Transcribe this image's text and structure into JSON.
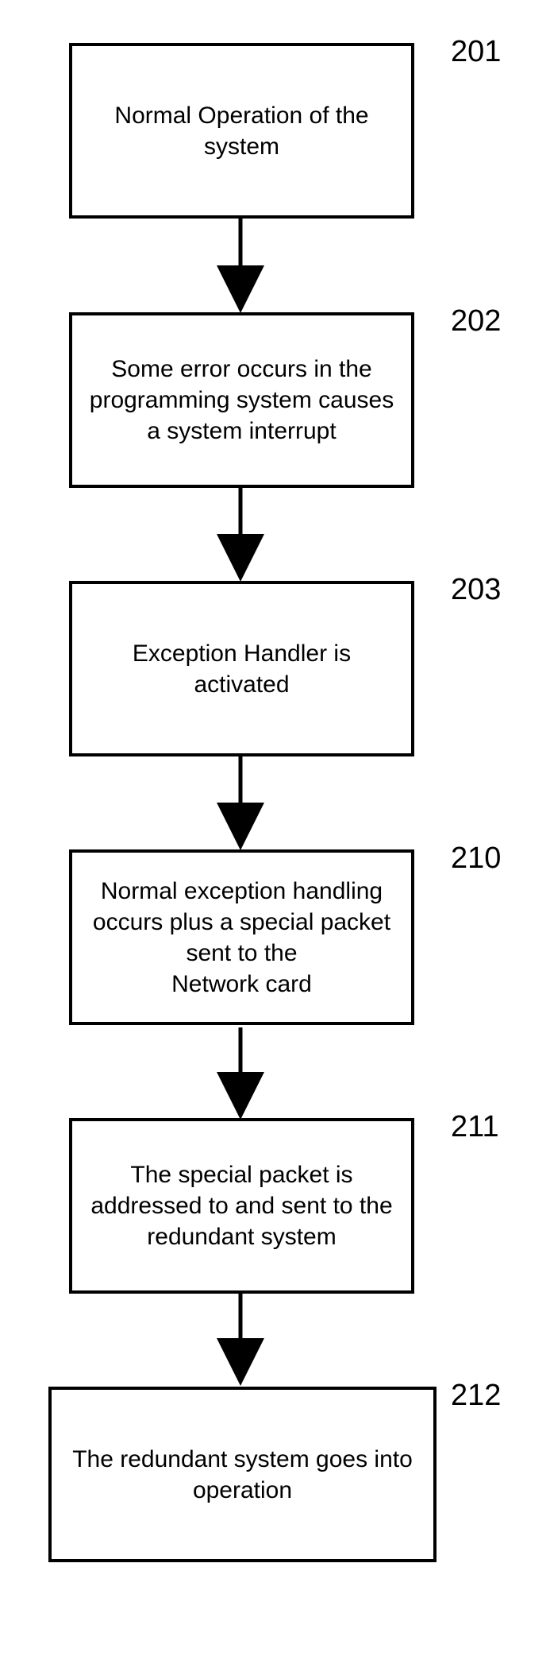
{
  "steps": [
    {
      "id": "201",
      "text": "Normal Operation of the system"
    },
    {
      "id": "202",
      "text": "Some error occurs in the programming system causes  a  system interrupt"
    },
    {
      "id": "203",
      "text": "Exception Handler is activated"
    },
    {
      "id": "210",
      "text": "Normal exception handling occurs plus a special packet sent to the\nNetwork card"
    },
    {
      "id": "211",
      "text": "The special packet is addressed to and sent to the redundant system"
    },
    {
      "id": "212",
      "text": "The redundant system goes into operation"
    }
  ]
}
